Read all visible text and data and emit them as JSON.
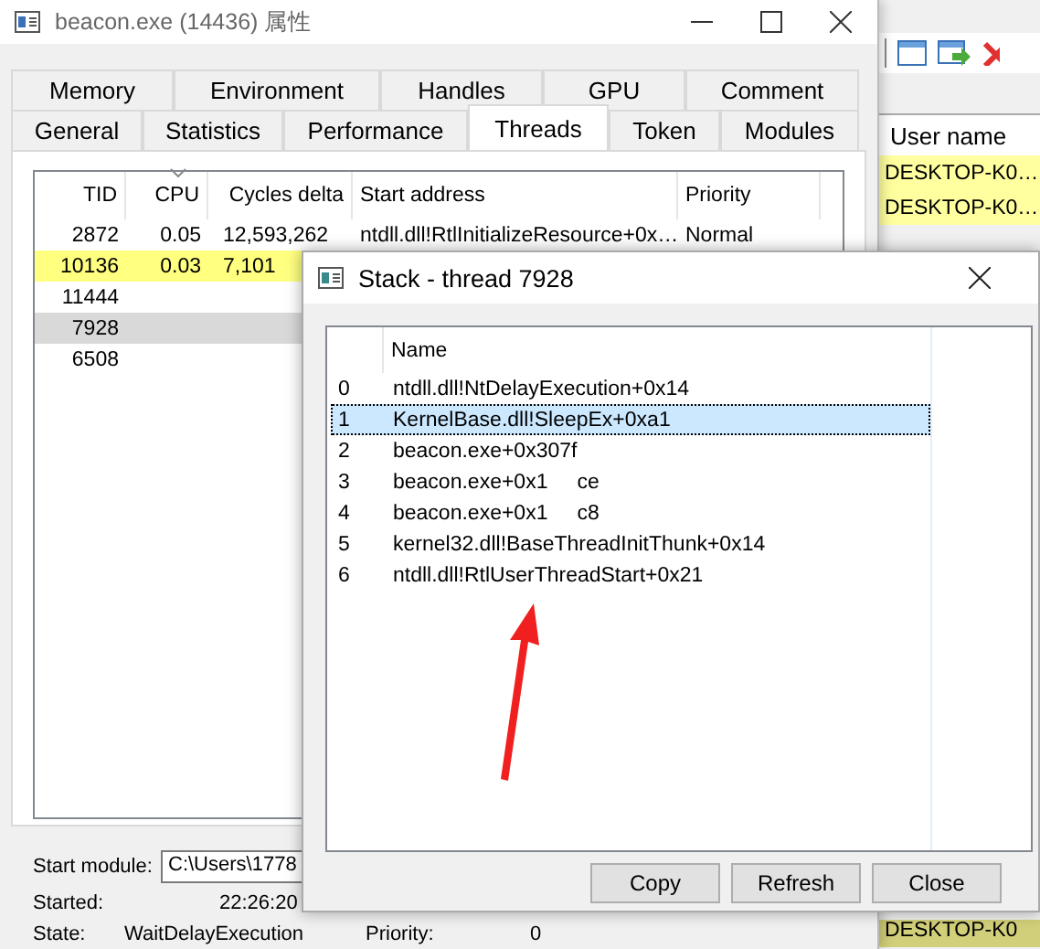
{
  "background_window": {
    "column_header": "User name",
    "rows": [
      "DESKTOP-K0…",
      "DESKTOP-K0…"
    ],
    "bottom_row": "DESKTOP-K0"
  },
  "properties_window": {
    "title": "beacon.exe (14436) 属性",
    "tab_rows": [
      [
        {
          "label": "Memory",
          "selected": false
        },
        {
          "label": "Environment",
          "selected": false
        },
        {
          "label": "Handles",
          "selected": false
        },
        {
          "label": "GPU",
          "selected": false
        },
        {
          "label": "Comment",
          "selected": false
        }
      ],
      [
        {
          "label": "General",
          "selected": false
        },
        {
          "label": "Statistics",
          "selected": false
        },
        {
          "label": "Performance",
          "selected": false
        },
        {
          "label": "Threads",
          "selected": true
        },
        {
          "label": "Token",
          "selected": false
        },
        {
          "label": "Modules",
          "selected": false
        }
      ]
    ],
    "threads": {
      "columns": [
        {
          "label": "TID",
          "sorted": false
        },
        {
          "label": "CPU",
          "sorted": true
        },
        {
          "label": "Cycles delta",
          "sorted": false
        },
        {
          "label": "Start address",
          "sorted": false
        },
        {
          "label": "Priority",
          "sorted": false
        }
      ],
      "rows": [
        {
          "cells": [
            "2872",
            "0.05",
            "12,593,262",
            "ntdll.dll!RtlInitializeResource+0x…",
            "Normal"
          ],
          "highlighted": false,
          "selected": false
        },
        {
          "cells": [
            "10136",
            "0.03",
            "7,101"
          ],
          "highlighted": true,
          "selected": false
        },
        {
          "cells": [
            "11444"
          ],
          "highlighted": false,
          "selected": false
        },
        {
          "cells": [
            "7928"
          ],
          "highlighted": false,
          "selected": true
        },
        {
          "cells": [
            "6508"
          ],
          "highlighted": false,
          "selected": false
        }
      ]
    },
    "details": [
      {
        "kind": "field",
        "label": "Start module:",
        "value": "C:\\Users\\1778"
      },
      {
        "kind": "text",
        "label": "Started:",
        "value": "22:26:20"
      },
      {
        "kind": "pair",
        "label": "State:",
        "value": "WaitDelayExecution",
        "label_2": "Priority:",
        "value_2": "0"
      }
    ]
  },
  "stack_window": {
    "title": "Stack - thread 7928",
    "column": "Name",
    "frames": [
      {
        "index": "0",
        "name": [
          "ntdll.dll!NtDelayExecution+0x14"
        ],
        "selected": false
      },
      {
        "index": "1",
        "name": [
          "KernelBase.dll!SleepEx+0xa1"
        ],
        "selected": true
      },
      {
        "index": "2",
        "name": [
          "beacon.exe+0x307f"
        ],
        "selected": false
      },
      {
        "index": "3",
        "name": [
          "beacon.exe+0x1",
          "ce"
        ],
        "selected": false
      },
      {
        "index": "4",
        "name": [
          "beacon.exe+0x1",
          "c8"
        ],
        "selected": false
      },
      {
        "index": "5",
        "name": [
          "kernel32.dll!BaseThreadInitThunk+0x14"
        ],
        "selected": false
      },
      {
        "index": "6",
        "name": [
          "ntdll.dll!RtlUserThreadStart+0x21"
        ],
        "selected": false
      }
    ],
    "buttons": [
      "Copy",
      "Refresh",
      "Close"
    ]
  }
}
